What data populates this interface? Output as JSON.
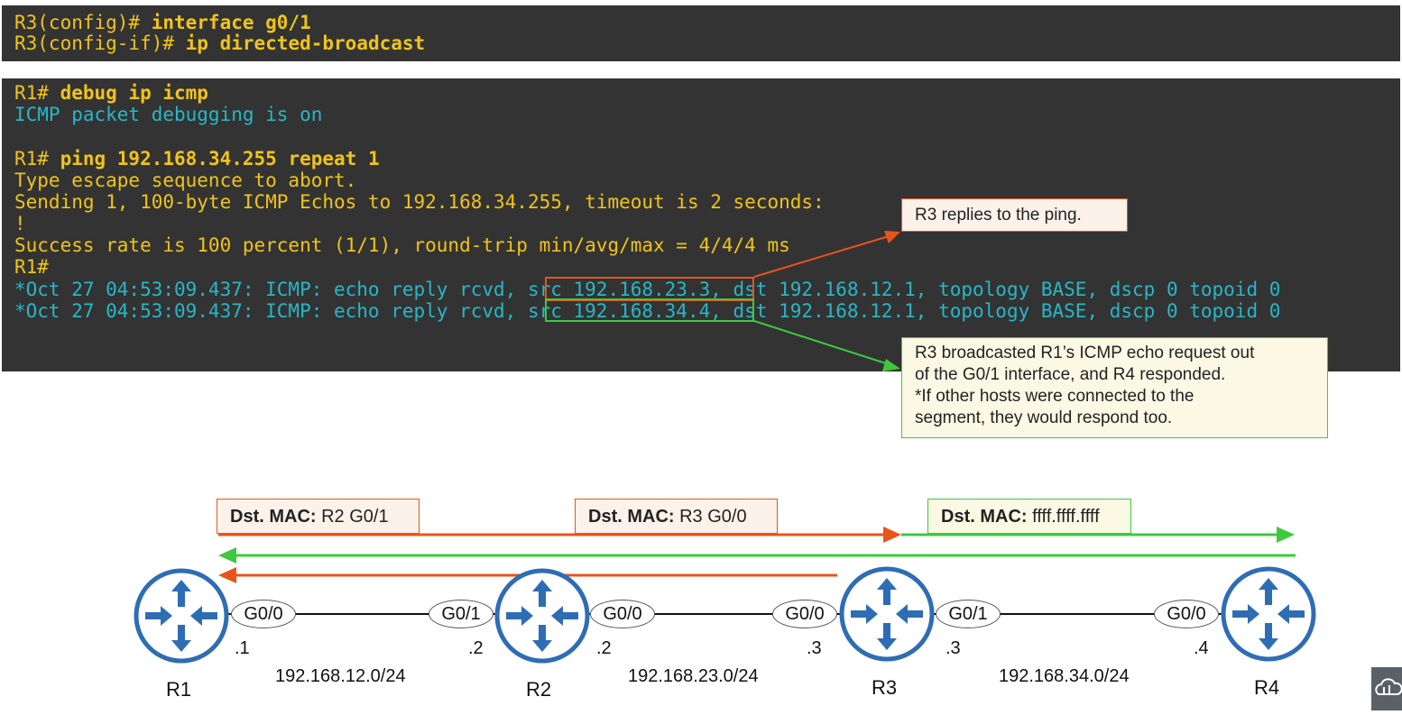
{
  "terminal1": {
    "lines": [
      {
        "prompt": "R3(config)# ",
        "cmd": "interface g0/1"
      },
      {
        "prompt": "R3(config-if)# ",
        "cmd": "ip directed-broadcast"
      }
    ]
  },
  "terminal2": {
    "l1_prompt": "R1# ",
    "l1_cmd": "debug ip icmp",
    "l2": "ICMP packet debugging is on",
    "l4_prompt": "R1# ",
    "l4_cmd": "ping 192.168.34.255 repeat 1",
    "l5": "Type escape sequence to abort.",
    "l6": "Sending 1, 100-byte ICMP Echos to 192.168.34.255, timeout is 2 seconds:",
    "l7": "!",
    "l8": "Success rate is 100 percent (1/1), round-trip min/avg/max = 4/4/4 ms",
    "l9": "R1#",
    "debug1": "*Oct 27 04:53:09.437: ICMP: echo reply rcvd, src 192.168.23.3, dst 192.168.12.1, topology BASE, dscp 0 topoid 0",
    "debug2": "*Oct 27 04:53:09.437: ICMP: echo reply rcvd, src 192.168.34.4, dst 192.168.12.1, topology BASE, dscp 0 topoid 0"
  },
  "callouts": {
    "r3_reply": "R3 replies to the ping.",
    "broadcast_1": "R3 broadcasted R1’s ICMP echo request out",
    "broadcast_2": "of the G0/1 interface, and R4 responded.",
    "broadcast_3": "*If other hosts were connected to the",
    "broadcast_4": "segment, they would respond too."
  },
  "mac_labels": [
    {
      "key": "Dst. MAC:",
      "value": " R2 G0/1"
    },
    {
      "key": "Dst. MAC:",
      "value": " R3 G0/0"
    },
    {
      "key": "Dst. MAC:",
      "value": " ffff.ffff.ffff"
    }
  ],
  "routers": [
    "R1",
    "R2",
    "R3",
    "R4"
  ],
  "interfaces": [
    "G0/0",
    "G0/1",
    "G0/0",
    "G0/0",
    "G0/1",
    "G0/0"
  ],
  "host_ips": [
    ".1",
    ".2",
    ".2",
    ".3",
    ".3",
    ".4"
  ],
  "networks": [
    "192.168.12.0/24",
    "192.168.23.0/24",
    "192.168.34.0/24"
  ],
  "colors": {
    "terminal_bg": "#333333",
    "prompt_yellow": "#f0c419",
    "output_cyan": "#28b7c6",
    "orange": "#e8541a",
    "green": "#3ec93e",
    "router_blue": "#2e6db4"
  },
  "icons": {
    "router": "router-icon",
    "corner_logo": "cloud-logo-icon"
  }
}
